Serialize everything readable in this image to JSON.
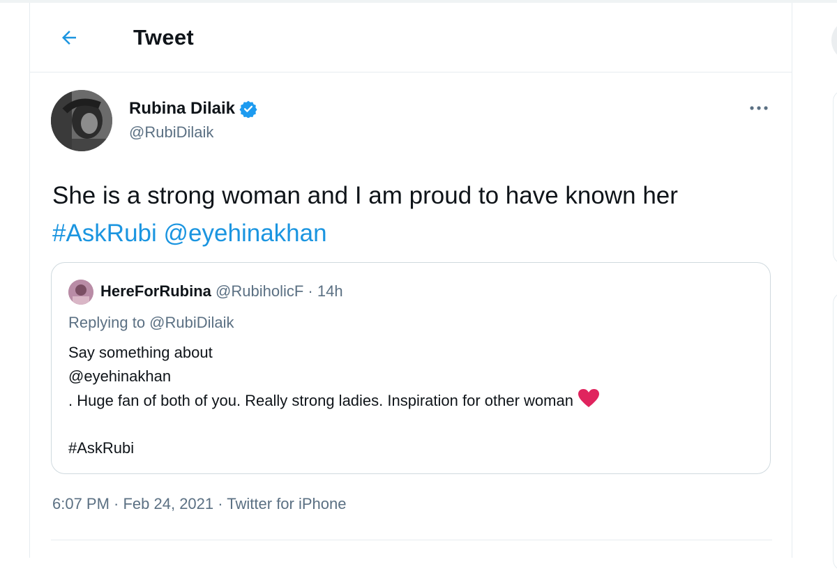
{
  "header": {
    "back_icon": "arrow-left-icon",
    "title": "Tweet"
  },
  "tweet": {
    "author": {
      "name": "Rubina Dilaik",
      "handle": "@RubiDilaik",
      "verified_icon": "verified-badge-icon"
    },
    "more_icon": "more-dots-icon",
    "text_plain": "She is a strong woman and I am proud to have known her ",
    "hashtag": "#AskRubi",
    "mention": "@eyehinakhan",
    "timestamp": "6:07 PM · Feb 24, 2021 · Twitter for iPhone"
  },
  "quoted": {
    "name": "HereForRubina",
    "meta": "@RubiholicF · 14h",
    "replying_to": "Replying to @RubiDilaik",
    "body": "Say something about\n@eyehinakhan\n . Huge fan of both of you. Really strong ladies. Inspiration for other woman",
    "heart_icon": "heart-emoji-icon",
    "hashtag": "#AskRubi"
  },
  "colors": {
    "accent": "#1b95e0",
    "verified": "#1d9bf0",
    "secondary_text": "#5b7083",
    "heart": "#e0245e"
  }
}
